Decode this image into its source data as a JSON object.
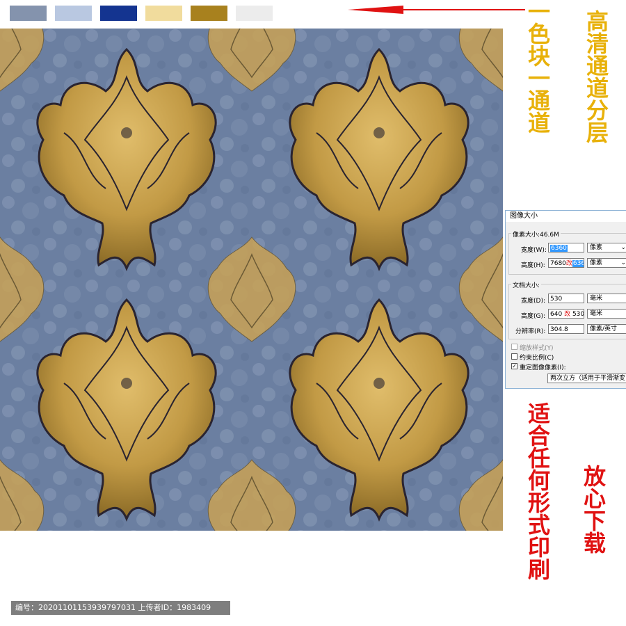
{
  "swatches": [
    {
      "name": "swatch-gray-blue",
      "color": "#8493ad"
    },
    {
      "name": "swatch-light-blue",
      "color": "#b9c8e1"
    },
    {
      "name": "swatch-navy",
      "color": "#143490"
    },
    {
      "name": "swatch-cream",
      "color": "#f1dc9d"
    },
    {
      "name": "swatch-gold",
      "color": "#a8811e"
    },
    {
      "name": "swatch-light-gray",
      "color": "#ececec"
    }
  ],
  "annotations": {
    "one_block_one_channel": "一色块一通道",
    "hd_channel_layers": "高清通道分层",
    "any_print_form": "适合任何形式印刷",
    "download_safely": "放心下载"
  },
  "colors": {
    "pattern_bg": "#6b7fa1",
    "gold": "#c79d45",
    "annotation_yellow": "#e8b10a",
    "annotation_red": "#e01212"
  },
  "dialog": {
    "title": "图像大小",
    "pixel_size": "像素大小:46.6M",
    "width_label": "宽度(W):",
    "width_value": "6360",
    "width_unit": "像素",
    "height_label": "高度(H):",
    "height_old": "7680",
    "height_change": "改",
    "height_value": "6360",
    "height_unit": "像素",
    "doc_size": "文档大小:",
    "doc_width_label": "宽度(D):",
    "doc_width_value": "530",
    "doc_width_unit": "毫米",
    "doc_height_label": "高度(G):",
    "doc_height_old": "640",
    "doc_height_change": "改",
    "doc_height_value": "530",
    "doc_height_unit": "毫米",
    "resolution_label": "分辨率(R):",
    "resolution_value": "304.8",
    "resolution_unit": "像素/英寸",
    "scale_styles": "缩放样式(Y)",
    "constrain": "约束比例(C)",
    "resample": "重定图像像素(I):",
    "resample_method": "两次立方（适用于平滑渐变"
  },
  "footer": {
    "text": "编号：20201101153939797031 上传者ID：1983409"
  }
}
